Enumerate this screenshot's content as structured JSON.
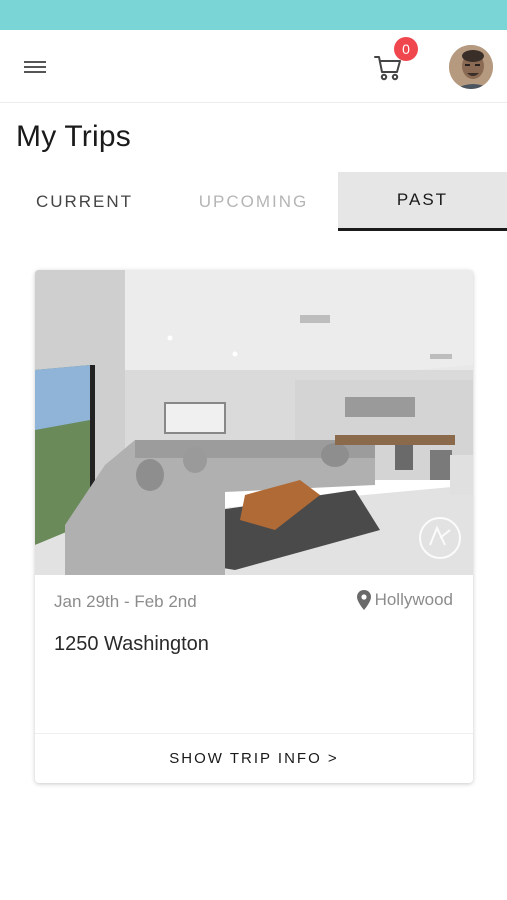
{
  "header": {
    "menu_icon": "hamburger-menu-icon",
    "cart_icon": "shopping-cart-icon",
    "cart_count": "0",
    "accent_color": "#7ad6d6",
    "badge_color": "#f0474f"
  },
  "page": {
    "title": "My Trips"
  },
  "tabs": [
    {
      "label": "CURRENT",
      "state": "inactive"
    },
    {
      "label": "UPCOMING",
      "state": "disabled"
    },
    {
      "label": "PAST",
      "state": "active"
    }
  ],
  "trip_card": {
    "dates": "Jan 29th - Feb 2nd",
    "location_icon": "map-pin-icon",
    "location": "Hollywood",
    "address": "1250 Washington",
    "action_label": "SHOW TRIP INFO >",
    "photo_icon": "living-room-photo"
  }
}
